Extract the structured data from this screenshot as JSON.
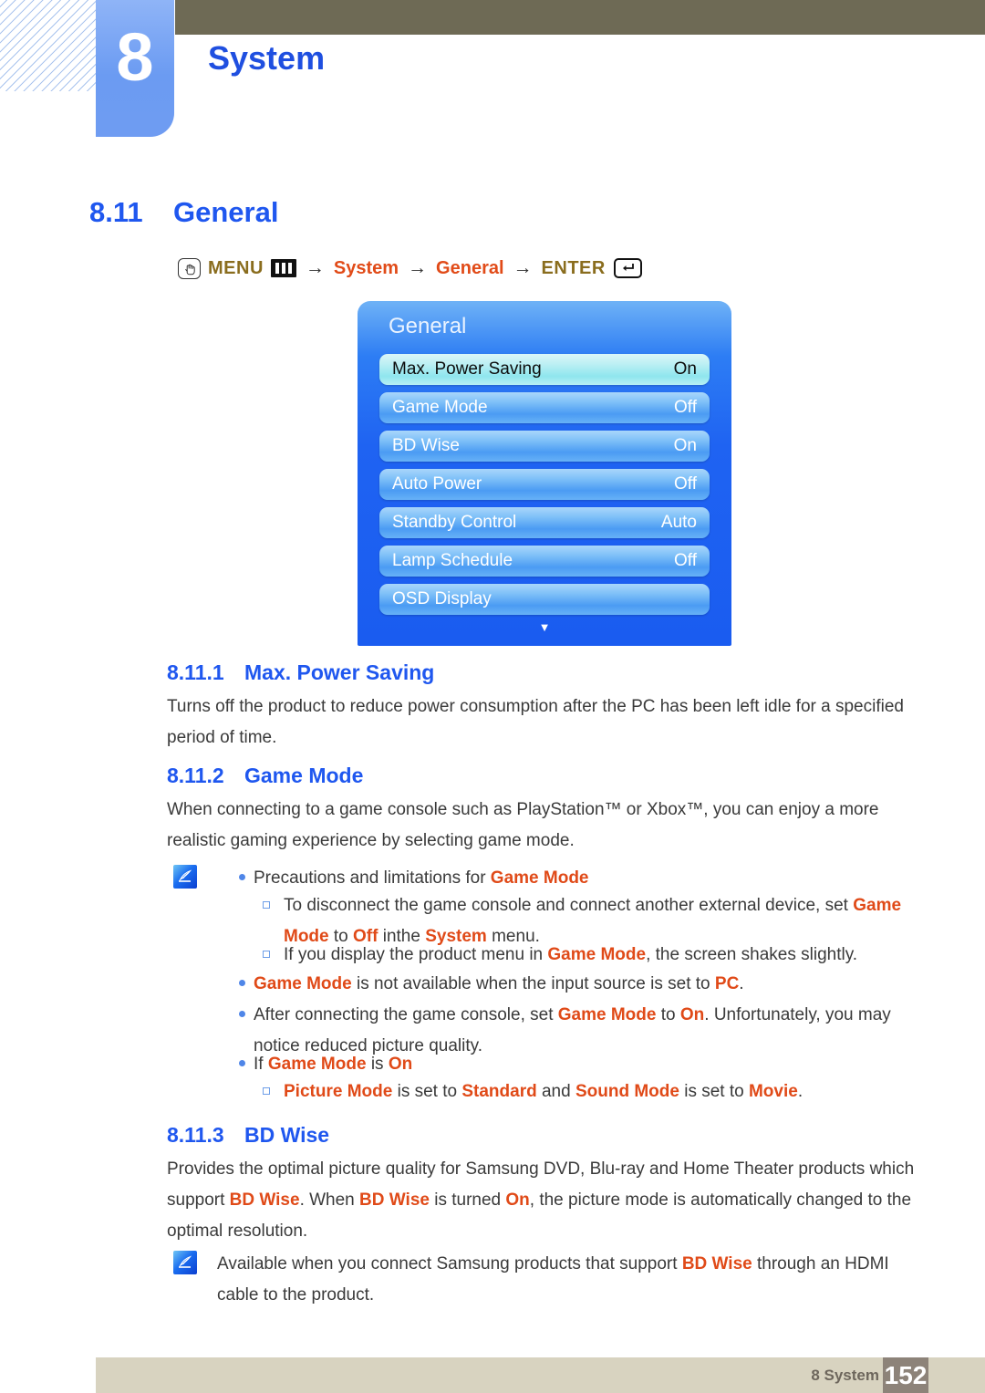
{
  "header": {
    "chapter_number": "8",
    "chapter_title": "System"
  },
  "section": {
    "number": "8.11",
    "title": "General"
  },
  "menu_path": {
    "menu_label": "MENU",
    "arrow": "→",
    "item1": "System",
    "item2": "General",
    "enter_label": "ENTER",
    "hand_icon": "hand-pointer-icon",
    "menu_icon": "menu-bars-icon",
    "enter_icon": "enter-return-icon"
  },
  "osd": {
    "title": "General",
    "rows": [
      {
        "label": "Max. Power Saving",
        "value": "On",
        "selected": true
      },
      {
        "label": "Game Mode",
        "value": "Off",
        "selected": false
      },
      {
        "label": "BD Wise",
        "value": "On",
        "selected": false
      },
      {
        "label": "Auto Power",
        "value": "Off",
        "selected": false
      },
      {
        "label": "Standby Control",
        "value": "Auto",
        "selected": false
      },
      {
        "label": "Lamp Schedule",
        "value": "Off",
        "selected": false
      },
      {
        "label": "OSD Display",
        "value": "",
        "selected": false
      }
    ],
    "scroll_arrow": "▼"
  },
  "subsections": {
    "s1": {
      "number": "8.11.1",
      "title": "Max. Power Saving"
    },
    "s2": {
      "number": "8.11.2",
      "title": "Game Mode"
    },
    "s3": {
      "number": "8.11.3",
      "title": "BD Wise"
    }
  },
  "paragraphs": {
    "p1": "Turns off the product to reduce power consumption after the PC has been left idle for a specified period of time.",
    "p2": "When connecting to a game console such as PlayStation™ or Xbox™, you can enjoy a more realistic gaming experience by selecting game mode.",
    "p3_a": "Provides the optimal picture quality for Samsung DVD, Blu-ray and Home Theater products which support ",
    "p3_b": "BD Wise",
    "p3_c": ". When ",
    "p3_d": "BD Wise",
    "p3_e": " is turned ",
    "p3_f": "On",
    "p3_g": ", the picture mode is automatically changed to the optimal resolution."
  },
  "notes": {
    "n1": {
      "b1_a": "Precautions and limitations for ",
      "b1_b": "Game Mode",
      "s1_a": "To disconnect the game console and connect another external device, set ",
      "s1_b": "Game Mode",
      "s1_c": " to ",
      "s1_d": "Off",
      "s1_e": " inthe ",
      "s1_f": "System",
      "s1_g": " menu.",
      "s2_a": "If you display the product menu in ",
      "s2_b": "Game Mode",
      "s2_c": ", the screen shakes slightly.",
      "b2_a": "Game Mode",
      "b2_b": " is not available when the input source is set to ",
      "b2_c": "PC",
      "b2_d": ".",
      "b3_a": "After connecting the game console, set ",
      "b3_b": "Game Mode",
      "b3_c": " to ",
      "b3_d": "On",
      "b3_e": ". Unfortunately, you may notice reduced picture quality.",
      "b4_a": "If ",
      "b4_b": "Game Mode",
      "b4_c": " is ",
      "b4_d": "On",
      "s3_a": "Picture Mode",
      "s3_b": " is set to ",
      "s3_c": "Standard",
      "s3_d": " and ",
      "s3_e": "Sound Mode",
      "s3_f": " is set to ",
      "s3_g": "Movie",
      "s3_h": "."
    },
    "n2": {
      "a": "Available when you connect Samsung products that support ",
      "b": "BD Wise",
      "c": " through an HDMI cable to the product."
    },
    "icon": "note-pen-icon"
  },
  "footer": {
    "label": "8 System",
    "page": "152"
  },
  "colors": {
    "heading_blue": "#1f57ef",
    "highlight_red": "#e04a18",
    "menu_gold": "#8a6d1e",
    "menu_red": "#e14b18",
    "topbar_olive": "#6e6a55",
    "footer_tan": "#d8d3c0",
    "footer_page_box": "#8d8379"
  }
}
